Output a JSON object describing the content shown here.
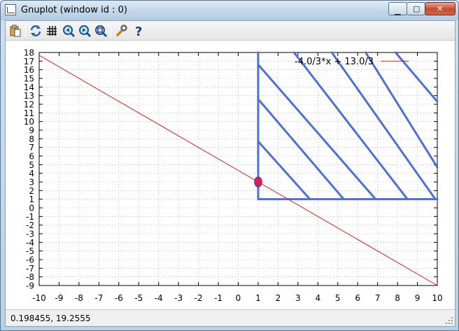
{
  "window": {
    "title": "Gnuplot (window id : 0)"
  },
  "toolbar": {
    "buttons": [
      {
        "name": "copy-to-clipboard-icon"
      },
      {
        "name": "replot-icon"
      },
      {
        "name": "grid-icon"
      },
      {
        "name": "zoom-previous-icon"
      },
      {
        "name": "zoom-next-icon"
      },
      {
        "name": "unzoom-icon"
      },
      {
        "name": "options-icon"
      },
      {
        "name": "help-icon"
      }
    ]
  },
  "status": {
    "mouse_coordinates": "0.198455,  19.2555"
  },
  "colors": {
    "line": "#cc2222",
    "hatch": "#4f6fd6",
    "point": "#dd2233",
    "grid": "#999999"
  },
  "chart_data": {
    "type": "line",
    "title": "",
    "xlabel": "",
    "ylabel": "",
    "xlim": [
      -10,
      10
    ],
    "ylim": [
      -9,
      18
    ],
    "xticks": [
      "-10",
      "-9",
      "-8",
      "-7",
      "-6",
      "-5",
      "-4",
      "-3",
      "-2",
      "-1",
      "0",
      "1",
      "2",
      "3",
      "4",
      "5",
      "6",
      "7",
      "8",
      "9",
      "10"
    ],
    "yticks": [
      "18",
      "17",
      "16",
      "15",
      "14",
      "13",
      "12",
      "11",
      "10",
      "9",
      "8",
      "7",
      "6",
      "5",
      "4",
      "3",
      "2",
      "1",
      "0",
      "-1",
      "-2",
      "-3",
      "-4",
      "-5",
      "-6",
      "-7",
      "-8",
      "-9"
    ],
    "grid": true,
    "legend": "top-right",
    "series": [
      {
        "name": "-4.0/3*x + 13.0/3",
        "x": [
          -10,
          10
        ],
        "y": [
          17.6667,
          -9
        ]
      }
    ],
    "feasible_region": {
      "x_min": 1,
      "y_min": 1,
      "hatch_segments": [
        {
          "from": [
            1,
            7.7
          ],
          "to": [
            3.6,
            1
          ]
        },
        {
          "from": [
            1,
            12.6
          ],
          "to": [
            5.3,
            1
          ]
        },
        {
          "from": [
            1,
            16.6
          ],
          "to": [
            6.9,
            1
          ]
        },
        {
          "from": [
            2.8,
            18
          ],
          "to": [
            8.5,
            1
          ]
        },
        {
          "from": [
            4.7,
            18
          ],
          "to": [
            9.9,
            1
          ]
        },
        {
          "from": [
            6.4,
            18
          ],
          "to": [
            10,
            4.7
          ]
        },
        {
          "from": [
            7.9,
            18
          ],
          "to": [
            10,
            12.3
          ]
        }
      ]
    },
    "point": {
      "x": 1,
      "y": 3
    }
  }
}
